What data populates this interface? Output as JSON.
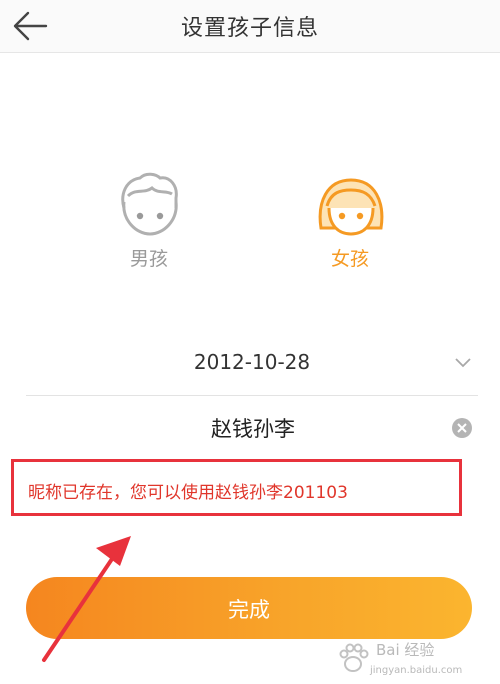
{
  "header": {
    "title": "设置孩子信息"
  },
  "gender": {
    "boy_label": "男孩",
    "girl_label": "女孩",
    "selected": "girl"
  },
  "birthday": {
    "value": "2012-10-28"
  },
  "nickname": {
    "value": "赵钱孙李"
  },
  "error": {
    "message": "昵称已存在，您可以使用赵钱孙李201103"
  },
  "actions": {
    "submit_label": "完成"
  },
  "watermark": {
    "brand": "Bai 经验",
    "url": "jingyan.baidu.com"
  },
  "colors": {
    "accent": "#f59a23",
    "error": "#e8323c",
    "inactive": "#9a9a9a"
  }
}
